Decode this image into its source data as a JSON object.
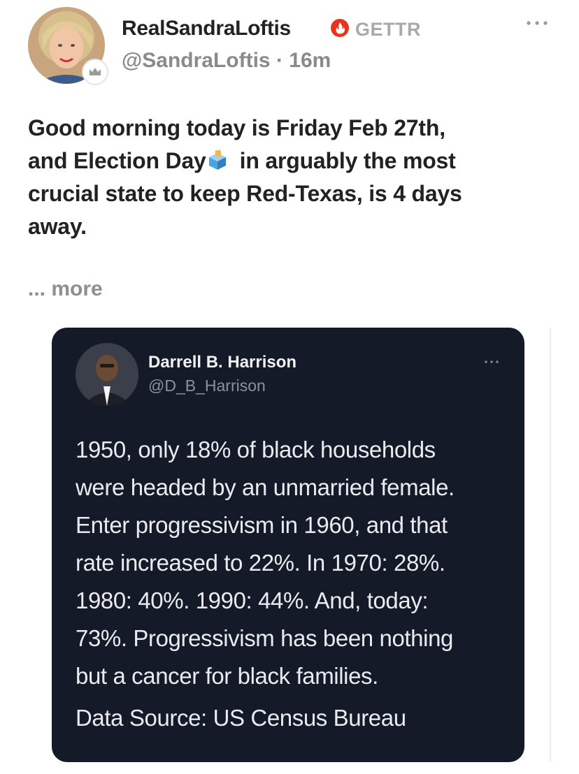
{
  "post": {
    "author": {
      "display_name": "RealSandraLoftis",
      "brand": "GETTR",
      "handle": "@SandraLoftis",
      "separator": " · ",
      "time": "16m"
    },
    "body": {
      "line1": "Good morning today is Friday Feb 27th,",
      "line2_before": "and Election Day",
      "line2_after": "in arguably the most",
      "line3": "crucial state to keep Red-Texas, is 4 days",
      "line4": "away."
    },
    "read_more": "... more"
  },
  "embedded_tweet": {
    "author_name": "Darrell B. Harrison",
    "author_handle": "@D_B_Harrison",
    "lines": [
      "1950, only 18% of black households",
      "were headed by an unmarried female.",
      "Enter progressivism in 1960, and that",
      "rate increased to 22%. In 1970: 28%.",
      "1980: 40%. 1990: 44%. And, today:",
      "73%. Progressivism has been nothing",
      "but a cancer for black families."
    ],
    "source": "Data Source: US Census Bureau"
  },
  "colors": {
    "verified_red": "#e8341c",
    "embed_bg": "#141a27"
  },
  "icons": {
    "verified": "verified-flame-icon",
    "ballot": "ballot-box-icon",
    "more": "more-options-icon",
    "badge": "crown-badge-icon"
  }
}
